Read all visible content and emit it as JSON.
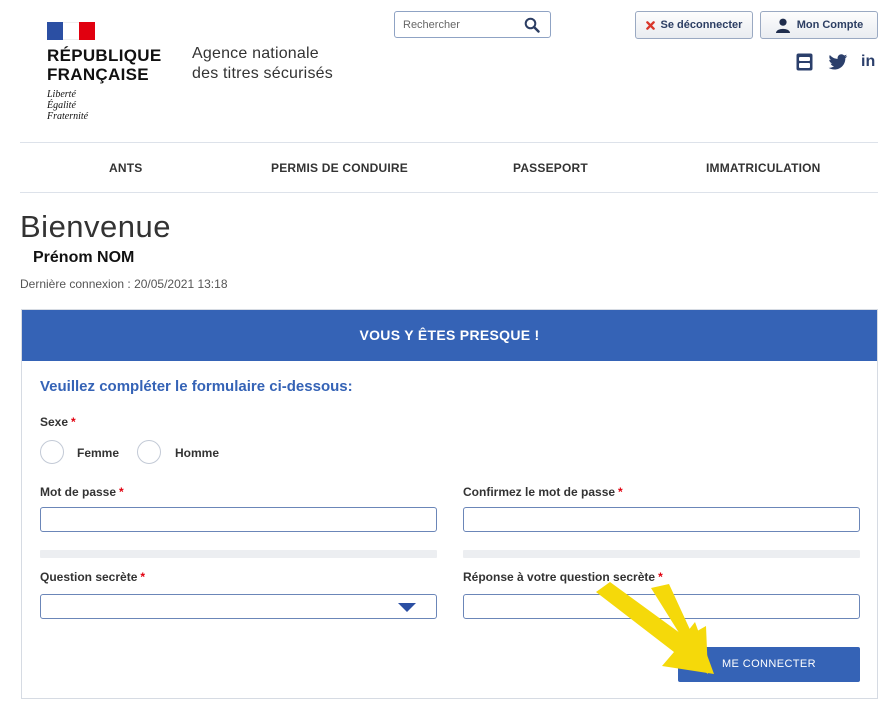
{
  "header": {
    "republic_line1": "RÉPUBLIQUE",
    "republic_line2": "FRANÇAISE",
    "motto": [
      "Liberté",
      "Égalité",
      "Fraternité"
    ],
    "agency_line1": "Agence nationale",
    "agency_line2": "des titres sécurisés",
    "search_placeholder": "Rechercher",
    "logout_label": "Se déconnecter",
    "account_label": "Mon Compte",
    "social": {
      "youtube_icon": "youtube-icon",
      "twitter_icon": "twitter-icon",
      "linkedin_label": "in"
    }
  },
  "nav": {
    "items": [
      "ANTS",
      "PERMIS DE CONDUIRE",
      "PASSEPORT",
      "IMMATRICULATION"
    ]
  },
  "welcome": {
    "title": "Bienvenue",
    "user_name": "Prénom NOM",
    "last_login": "Dernière connexion : 20/05/2021 13:18"
  },
  "form": {
    "banner": "VOUS Y ÊTES PRESQUE !",
    "title": "Veuillez compléter le formulaire ci-dessous:",
    "sex_label": "Sexe",
    "required_mark": "*",
    "sex_options": [
      "Femme",
      "Homme"
    ],
    "password_label": "Mot de passe",
    "password_value": "",
    "confirm_label": "Confirmez le mot de passe",
    "confirm_value": "",
    "question_label": "Question secrète",
    "question_selected": "",
    "answer_label": "Réponse à votre question secrète",
    "answer_value": "",
    "submit_label": "ME CONNECTER"
  },
  "colors": {
    "primary_blue": "#3563b6",
    "flag_blue": "#2b4fa3",
    "flag_red": "#e1000f",
    "annotation_arrow": "#f5d90a"
  }
}
